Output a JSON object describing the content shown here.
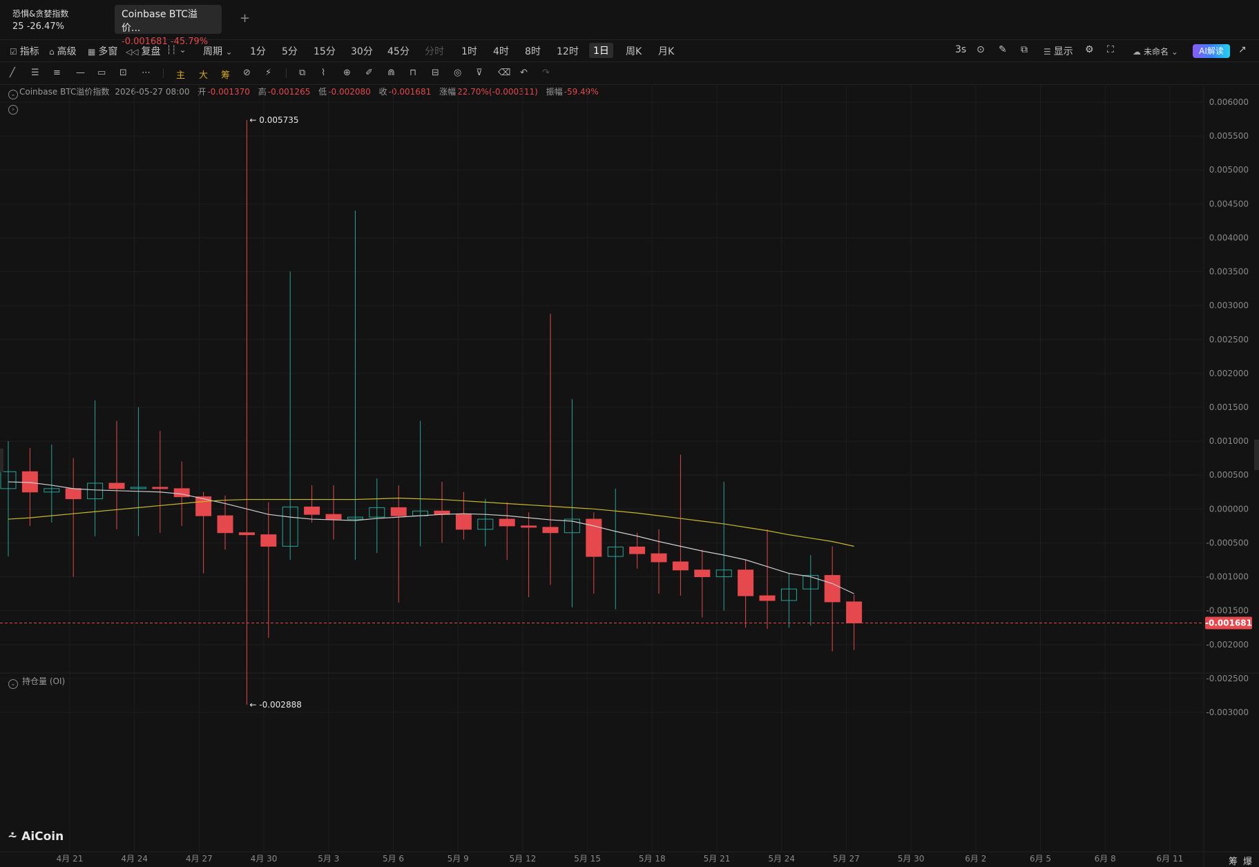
{
  "tabs": [
    {
      "title": "恐惧&贪婪指数",
      "value": "25",
      "change": "-26.47%"
    },
    {
      "title": "Coinbase BTC溢价...",
      "value": "-0.001681",
      "change": "-45.79%"
    }
  ],
  "add_tab": "+",
  "toolbar": {
    "indicator": "指标",
    "advanced": "高级",
    "multi_window": "多窗",
    "replay": "复盘",
    "period": "周期",
    "intervals": [
      "1分",
      "5分",
      "15分",
      "30分",
      "45分",
      "分时",
      "1时",
      "4时",
      "8时",
      "12时",
      "1日",
      "周K",
      "月K"
    ],
    "selected_interval": "1日",
    "refresh": "3s",
    "display": "显示",
    "layout_name": "未命名",
    "ai": "AI解读"
  },
  "drawbar": {
    "main": "主",
    "large": "大",
    "chips": "筹"
  },
  "info": {
    "name": "Coinbase BTC溢价指数",
    "datetime": "2026-05-27 08:00",
    "open_label": "开",
    "open": "-0.001370",
    "high_label": "高",
    "high": "-0.001265",
    "low_label": "低",
    "low": "-0.002080",
    "close_label": "收",
    "close": "-0.001681",
    "change_label": "涨幅",
    "change": "22.70%(-0.000311)",
    "amp_label": "振幅",
    "amp": "-59.49%"
  },
  "oi_label": "持仓量 (OI)",
  "logo": "AiCoin",
  "bottom_right": [
    "筹",
    "爆"
  ],
  "colors": {
    "up": "#26a69a",
    "down": "#e5484d",
    "ma_fast": "#cfcfcf",
    "ma_slow": "#c9b92e",
    "bg": "#131313"
  },
  "chart_data": {
    "type": "candlestick",
    "y_ticks": [
      "0.006000",
      "0.005500",
      "0.005000",
      "0.004500",
      "0.004000",
      "0.003500",
      "0.003000",
      "0.002500",
      "0.002000",
      "0.001500",
      "0.001000",
      "0.000500",
      "0.000000",
      "-0.000500",
      "-0.001000",
      "-0.001500",
      "-0.002000",
      "-0.002500",
      "-0.003000"
    ],
    "ylim": [
      -0.003,
      0.006
    ],
    "x_labels": [
      "4月 21",
      "4月 24",
      "4月 27",
      "4月 30",
      "5月 3",
      "5月 6",
      "5月 9",
      "5月 12",
      "5月 15",
      "5月 18",
      "5月 21",
      "5月 24",
      "5月 27",
      "5月 30",
      "6月 2",
      "6月 5",
      "6月 8",
      "6月 11"
    ],
    "last_price": "-0.001681",
    "max_label": "0.005735",
    "min_label": "-0.002888",
    "candles": [
      {
        "o": 0.0003,
        "c": 0.00055,
        "h": 0.001,
        "l": -0.0007
      },
      {
        "o": 0.00055,
        "c": 0.00025,
        "h": 0.0009,
        "l": -0.00025
      },
      {
        "o": 0.00025,
        "c": 0.0003,
        "h": 0.00095,
        "l": -0.0002
      },
      {
        "o": 0.0003,
        "c": 0.00015,
        "h": 0.00075,
        "l": -0.001
      },
      {
        "o": 0.00015,
        "c": 0.00038,
        "h": 0.0016,
        "l": -0.0004
      },
      {
        "o": 0.00038,
        "c": 0.0003,
        "h": 0.0013,
        "l": -0.0003
      },
      {
        "o": 0.0003,
        "c": 0.00032,
        "h": 0.0015,
        "l": -0.0004
      },
      {
        "o": 0.00032,
        "c": 0.0003,
        "h": 0.00115,
        "l": -0.00035
      },
      {
        "o": 0.0003,
        "c": 0.00018,
        "h": 0.0007,
        "l": -0.00025
      },
      {
        "o": 0.00018,
        "c": -0.0001,
        "h": 0.00025,
        "l": -0.00095
      },
      {
        "o": -0.0001,
        "c": -0.00035,
        "h": 0.0002,
        "l": -0.0006
      },
      {
        "o": -0.00035,
        "c": -0.00038,
        "h": 0.005735,
        "l": -0.002888
      },
      {
        "o": -0.00038,
        "c": -0.00055,
        "h": 0.0001,
        "l": -0.0019
      },
      {
        "o": -0.00055,
        "c": 3e-05,
        "h": 0.0035,
        "l": -0.00075
      },
      {
        "o": 3e-05,
        "c": -8e-05,
        "h": 0.00035,
        "l": -0.0002
      },
      {
        "o": -8e-05,
        "c": -0.00015,
        "h": 0.00035,
        "l": -0.00045
      },
      {
        "o": -0.00015,
        "c": -0.00012,
        "h": 0.0044,
        "l": -0.00075
      },
      {
        "o": -0.00012,
        "c": 2e-05,
        "h": 0.00045,
        "l": -0.00065
      },
      {
        "o": 2e-05,
        "c": -0.0001,
        "h": 0.00035,
        "l": -0.00138
      },
      {
        "o": -0.0001,
        "c": -3e-05,
        "h": 0.0013,
        "l": -0.00055
      },
      {
        "o": -3e-05,
        "c": -8e-05,
        "h": 0.0004,
        "l": -0.0005
      },
      {
        "o": -8e-05,
        "c": -0.0003,
        "h": 0.00025,
        "l": -0.00045
      },
      {
        "o": -0.0003,
        "c": -0.00015,
        "h": 0.00015,
        "l": -0.00055
      },
      {
        "o": -0.00015,
        "c": -0.00025,
        "h": 0.0001,
        "l": -0.00075
      },
      {
        "o": -0.00025,
        "c": -0.00027,
        "h": -5e-05,
        "l": -0.0013
      },
      {
        "o": -0.00027,
        "c": -0.00035,
        "h": 0.00288,
        "l": -0.00112
      },
      {
        "o": -0.00035,
        "c": -0.00015,
        "h": 0.00162,
        "l": -0.00145
      },
      {
        "o": -0.00015,
        "c": -0.0007,
        "h": -5e-05,
        "l": -0.00125
      },
      {
        "o": -0.0007,
        "c": -0.00056,
        "h": 0.0003,
        "l": -0.00148
      },
      {
        "o": -0.00056,
        "c": -0.00066,
        "h": -0.00035,
        "l": -0.00088
      },
      {
        "o": -0.00066,
        "c": -0.00078,
        "h": -0.0003,
        "l": -0.00125
      },
      {
        "o": -0.00078,
        "c": -0.0009,
        "h": 0.0008,
        "l": -0.00128
      },
      {
        "o": -0.0009,
        "c": -0.001,
        "h": -0.0006,
        "l": -0.0016
      },
      {
        "o": -0.001,
        "c": -0.0009,
        "h": 0.0004,
        "l": -0.0015
      },
      {
        "o": -0.0009,
        "c": -0.00128,
        "h": -0.00075,
        "l": -0.00175
      },
      {
        "o": -0.00128,
        "c": -0.00135,
        "h": -0.0003,
        "l": -0.00177
      },
      {
        "o": -0.00135,
        "c": -0.00118,
        "h": -0.00095,
        "l": -0.00175
      },
      {
        "o": -0.00118,
        "c": -0.00098,
        "h": -0.00068,
        "l": -0.00172
      },
      {
        "o": -0.00098,
        "c": -0.00137,
        "h": -0.00055,
        "l": -0.0021
      },
      {
        "o": -0.00137,
        "c": -0.001681,
        "h": -0.001265,
        "l": -0.00208
      }
    ],
    "ma_fast": [
      0.0004,
      0.00039,
      0.00035,
      0.0003,
      0.00028,
      0.00027,
      0.00026,
      0.00025,
      0.00022,
      0.00015,
      8e-05,
      0.0,
      -8e-05,
      -0.00012,
      -0.00015,
      -0.00016,
      -0.00017,
      -0.00014,
      -0.00012,
      -0.0001,
      -8e-05,
      -7e-05,
      -8e-05,
      -0.0001,
      -0.00013,
      -0.00016,
      -0.00018,
      -0.00025,
      -0.00033,
      -0.0004,
      -0.00048,
      -0.00055,
      -0.00062,
      -0.00068,
      -0.00075,
      -0.00085,
      -0.00095,
      -0.001,
      -0.0011,
      -0.00125
    ],
    "ma_slow": [
      -0.00015,
      -0.00013,
      -0.0001,
      -7e-05,
      -4e-05,
      -1e-05,
      2e-05,
      5e-05,
      8e-05,
      0.00011,
      0.00013,
      0.00014,
      0.00014,
      0.00014,
      0.00014,
      0.00014,
      0.00014,
      0.00015,
      0.00016,
      0.00015,
      0.00014,
      0.00012,
      0.0001,
      8e-05,
      6e-05,
      4e-05,
      2e-05,
      0.0,
      -3e-05,
      -6e-05,
      -0.0001,
      -0.00014,
      -0.00018,
      -0.00022,
      -0.00027,
      -0.00032,
      -0.00038,
      -0.00043,
      -0.00048,
      -0.00055
    ]
  }
}
